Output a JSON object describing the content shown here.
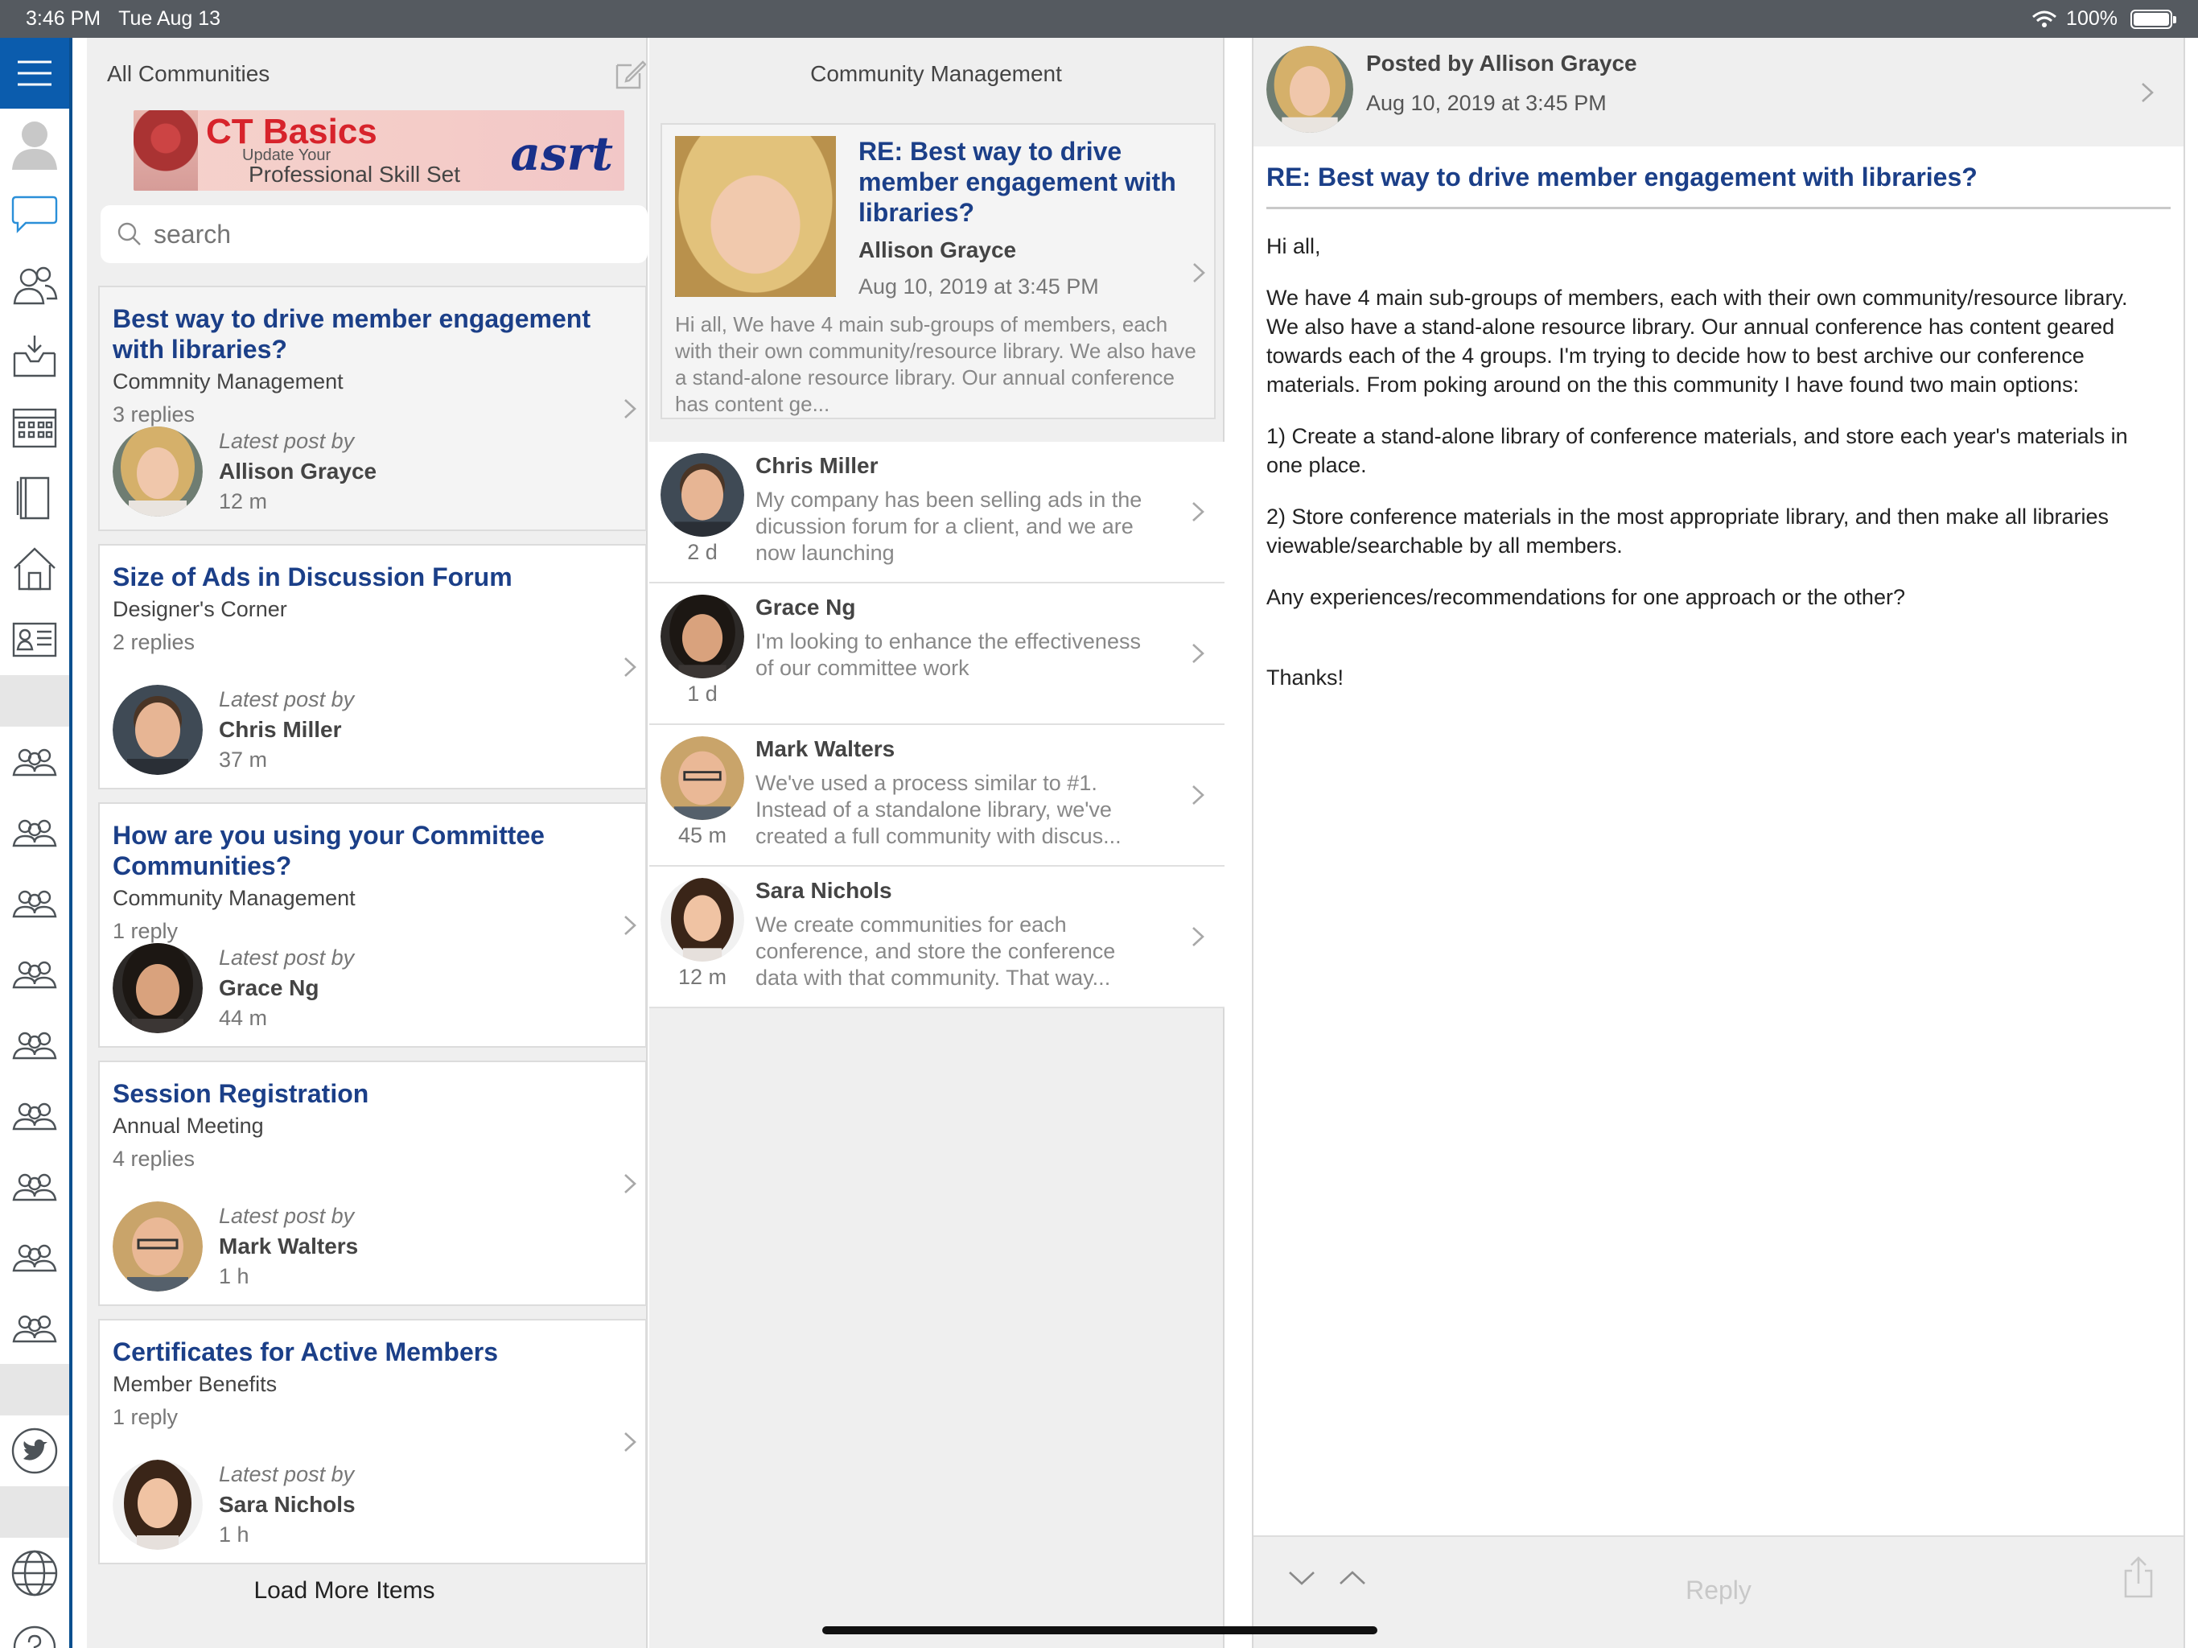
{
  "status_bar": {
    "time": "3:46 PM",
    "date": "Tue Aug 13",
    "battery": "100%"
  },
  "rail": {
    "icons": [
      "menu-icon",
      "profile-icon",
      "chat-icon",
      "contacts-icon",
      "inbox-icon",
      "calendar-icon",
      "book-icon",
      "home-icon",
      "directory-icon",
      "community-icon",
      "twitter-icon",
      "globe-icon",
      "help-icon"
    ]
  },
  "list_panel": {
    "header": "All Communities",
    "banner": {
      "title": "CT Basics",
      "line1": "Update Your",
      "line2": "Professional Skill Set",
      "brand": "asrt"
    },
    "search_placeholder": "search",
    "latest_label": "Latest post by",
    "threads": [
      {
        "title": "Best way to drive member engagement with libraries?",
        "community": "Commnity Management",
        "replies": "3 replies",
        "author": "Allison Grayce",
        "ago": "12 m"
      },
      {
        "title": "Size of Ads in Discussion Forum",
        "community": "Designer's Corner",
        "replies": "2 replies",
        "author": "Chris Miller",
        "ago": "37 m"
      },
      {
        "title": "How are you using your Committee Communities?",
        "community": "Community Management",
        "replies": "1 reply",
        "author": "Grace Ng",
        "ago": "44 m"
      },
      {
        "title": "Session Registration",
        "community": "Annual Meeting",
        "replies": "4 replies",
        "author": "Mark Walters",
        "ago": "1 h"
      },
      {
        "title": "Certificates for Active Members",
        "community": "Member Benefits",
        "replies": "1 reply",
        "author": "Sara Nichols",
        "ago": "1 h"
      }
    ],
    "load_more": "Load More Items"
  },
  "replies_panel": {
    "header": "Community Management",
    "root": {
      "title": "RE: Best way to drive member engagement with libraries?",
      "author": "Allison Grayce",
      "date": "Aug 10, 2019 at 3:45 PM",
      "excerpt": "Hi all, We have 4 main sub-groups of members, each with their own community/resource library. We also have a stand-alone resource library. Our annual conference has content ge..."
    },
    "replies": [
      {
        "name": "Chris Miller",
        "ago": "2 d",
        "text": "My company has been selling ads in the dicussion forum for a client, and we are now launching"
      },
      {
        "name": "Grace Ng",
        "ago": "1 d",
        "text": "I'm looking to enhance the effectiveness of our committee work"
      },
      {
        "name": "Mark Walters",
        "ago": "45 m",
        "text": "We've used a process similar to #1. Instead of a standalone library, we've created a full community with discus..."
      },
      {
        "name": "Sara Nichols",
        "ago": "12 m",
        "text": "We create communities for each conference, and store the conference data with that community.  That way..."
      }
    ]
  },
  "detail_panel": {
    "posted_by": "Posted by Allison Grayce",
    "date": "Aug 10, 2019 at 3:45 PM",
    "title": "RE: Best way to drive member engagement with libraries?",
    "body": [
      "Hi all,",
      "We have 4 main sub-groups of members, each with their own community/resource library.  We also have a stand-alone resource library.  Our annual conference has content geared towards each of the 4 groups.  I'm trying to decide how to best archive our conference materials.  From poking around on the this community I have found two main options:",
      "1) Create a stand-alone library of conference materials, and store each year's materials in one place.",
      "2) Store conference materials in the most appropriate library, and then make all libraries viewable/searchable by all members.",
      "Any experiences/recommendations for one approach or the other?",
      "Thanks!"
    ],
    "reply_label": "Reply"
  },
  "colors": {
    "accent": "#0b5cad",
    "title_blue": "#1b3f88",
    "status_bar": "#555a60"
  }
}
